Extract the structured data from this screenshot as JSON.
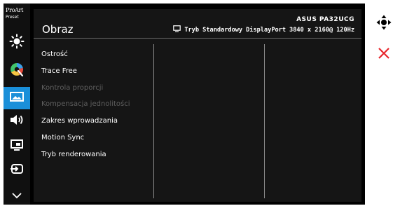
{
  "logo": {
    "line1": "ProArt",
    "line2": "Preset"
  },
  "header": {
    "title": "Obraz",
    "model": "ASUS PA32UCG",
    "mode": "Tryb Standardowy",
    "input": "DisplayPort",
    "resolution": "3840 x 2160@",
    "refresh": "120Hz"
  },
  "sidebar": {
    "items": [
      {
        "name": "brightness-icon",
        "active": false
      },
      {
        "name": "color-icon",
        "active": false
      },
      {
        "name": "image-icon",
        "active": true
      },
      {
        "name": "sound-icon",
        "active": false
      },
      {
        "name": "pip-icon",
        "active": false
      },
      {
        "name": "input-icon",
        "active": false
      },
      {
        "name": "chevron-down-icon",
        "active": false
      }
    ]
  },
  "menu": {
    "items": [
      {
        "label": "Ostrość",
        "enabled": true
      },
      {
        "label": "Trace Free",
        "enabled": true
      },
      {
        "label": "Kontrola proporcji",
        "enabled": false
      },
      {
        "label": "Kompensacja jednolitości",
        "enabled": false
      },
      {
        "label": "Zakres wprowadzania",
        "enabled": true
      },
      {
        "label": "Motion Sync",
        "enabled": true
      },
      {
        "label": "Tryb renderowania",
        "enabled": true
      }
    ]
  },
  "controls": {
    "navigate": "dpad-icon",
    "close": "close-icon"
  },
  "colors": {
    "accent": "#1a8fd9",
    "close": "#e8262c",
    "text": "#ffffff",
    "disabled_text": "#5f5f5f"
  }
}
